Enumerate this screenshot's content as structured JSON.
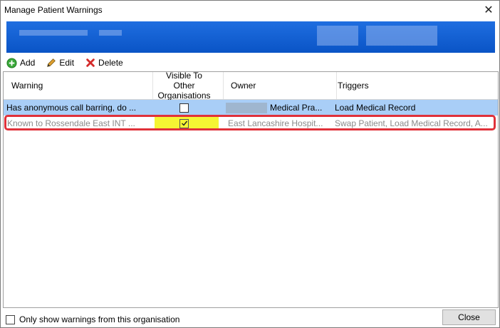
{
  "window": {
    "title": "Manage Patient Warnings",
    "close_glyph": "✕"
  },
  "toolbar": {
    "add_label": "Add",
    "edit_label": "Edit",
    "delete_label": "Delete"
  },
  "table": {
    "columns": [
      "Warning",
      "Visible To Other Organisations",
      "Owner",
      "Triggers"
    ],
    "rows": [
      {
        "warning": "Has anonymous call barring, do ...",
        "visible": false,
        "owner": "Medical Pra...",
        "triggers": "Load Medical Record"
      },
      {
        "warning": "Known to Rossendale East INT ...",
        "visible": true,
        "owner": "East Lancashire Hospit...",
        "triggers": "Swap Patient, Load Medical Record, A..."
      }
    ]
  },
  "footer": {
    "only_show_label": "Only show warnings from this organisation",
    "close_label": "Close"
  },
  "colors": {
    "banner": "#1565d8",
    "selected_row": "#a9cef7",
    "highlight": "#f5f533",
    "callout_border": "#e0313a",
    "muted_text": "#8a8a8a"
  }
}
